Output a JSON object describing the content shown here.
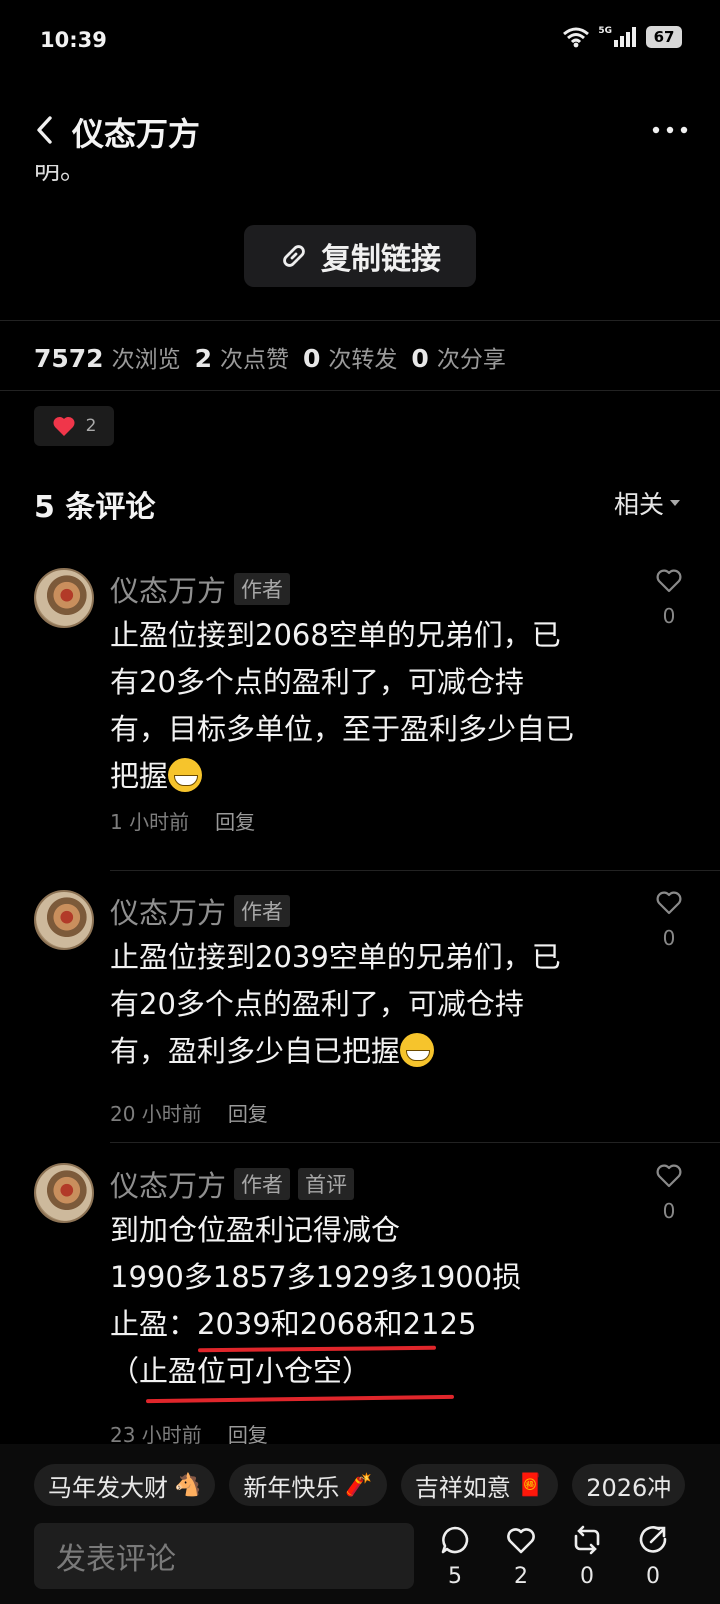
{
  "status": {
    "time": "10:39",
    "network": "5G",
    "battery": "67"
  },
  "nav": {
    "title": "仪态万方"
  },
  "partial_text": "明。",
  "copy_link": {
    "label": "复制链接"
  },
  "stats": [
    {
      "num": "7572",
      "label": "次浏览"
    },
    {
      "num": "2",
      "label": "次点赞"
    },
    {
      "num": "0",
      "label": "次转发"
    },
    {
      "num": "0",
      "label": "次分享"
    }
  ],
  "like_chip": {
    "count": "2"
  },
  "comments_header": {
    "title": "5 条评论",
    "sort": "相关"
  },
  "comments": [
    {
      "name": "仪态万方",
      "tags": [
        "作者"
      ],
      "lines": [
        "止盈位接到2068空单的兄弟们，已",
        "有20多个点的盈利了，可减仓持",
        "有，目标多单位，至于盈利多少自已",
        "把握"
      ],
      "time": "1 小时前",
      "reply": "回复",
      "likes": "0"
    },
    {
      "name": "仪态万方",
      "tags": [
        "作者"
      ],
      "lines": [
        "止盈位接到2039空单的兄弟们，已",
        "有20多个点的盈利了，可减仓持",
        "有，盈利多少自已把握"
      ],
      "time": "20 小时前",
      "reply": "回复",
      "likes": "0"
    },
    {
      "name": "仪态万方",
      "tags": [
        "作者",
        "首评"
      ],
      "lines": [
        "到加仓位盈利记得减仓",
        "1990多1857多1929多1900损",
        "止盈：2039和2068和2125",
        "（止盈位可小仓空）"
      ],
      "time": "23 小时前",
      "reply": "回复",
      "likes": "0"
    }
  ],
  "chips": [
    {
      "label": "马年发大财",
      "icon": "horse-icon"
    },
    {
      "label": "新年快乐",
      "icon": "firecracker-icon"
    },
    {
      "label": "吉祥如意",
      "icon": "red-envelope-icon"
    },
    {
      "label": "2026冲",
      "icon": ""
    }
  ],
  "input": {
    "placeholder": "发表评论"
  },
  "actions": [
    {
      "icon": "comment-icon",
      "count": "5"
    },
    {
      "icon": "heart-icon",
      "count": "2"
    },
    {
      "icon": "repost-icon",
      "count": "0"
    },
    {
      "icon": "share-icon",
      "count": "0"
    }
  ],
  "colors": {
    "background": "#000000",
    "accent_red": "#e0262b",
    "heart": "#f0364a"
  }
}
